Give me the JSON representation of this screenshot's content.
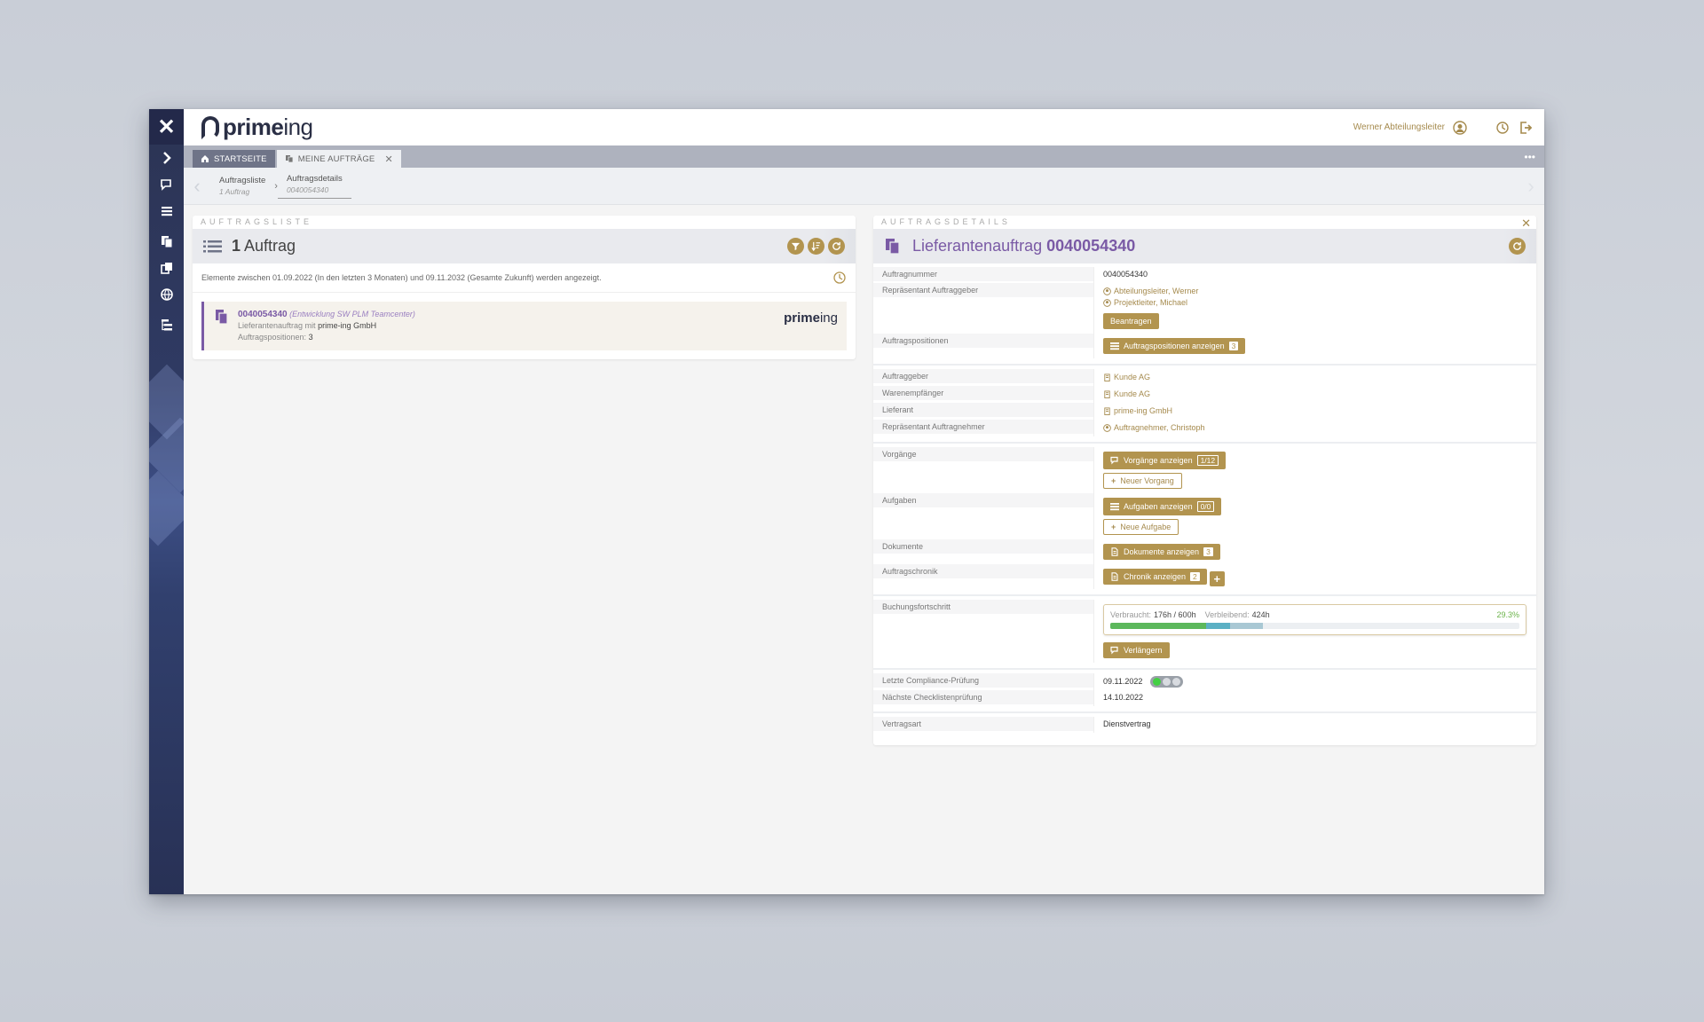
{
  "header": {
    "brand_prefix": "prime",
    "brand_suffix": "ing",
    "user_name": "Werner Abteilungsleiter"
  },
  "tabs": [
    {
      "label": "STARTSEITE"
    },
    {
      "label": "MEINE AUFTRÄGE"
    }
  ],
  "breadcrumb": [
    {
      "label": "Auftragsliste",
      "sub": "1 Auftrag"
    },
    {
      "label": "Auftragsdetails",
      "sub": "0040054340"
    }
  ],
  "left": {
    "section_title": "AUFTRAGSLISTE",
    "count": "1",
    "title_word": "Auftrag",
    "info": "Elemente zwischen 01.09.2022 (In den letzten 3 Monaten) und 09.11.2032 (Gesamte Zukunft) werden angezeigt.",
    "order": {
      "number": "0040054340",
      "subtitle": "(Entwicklung SW PLM Teamcenter)",
      "type_prefix": "Lieferantenauftrag mit",
      "supplier": "prime-ing GmbH",
      "positions_label": "Auftragspositionen:",
      "positions_value": "3",
      "logo_prefix": "prime",
      "logo_suffix": "ing"
    }
  },
  "right": {
    "section_title": "AUFTRAGSDETAILS",
    "title_prefix": "Lieferantenauftrag",
    "title_number": "0040054340",
    "fields": {
      "auftragsnummer_label": "Auftragnummer",
      "auftragsnummer": "0040054340",
      "repr_ag_label": "Repräsentant Auftraggeber",
      "repr_ag_1": "Abteilungsleiter, Werner",
      "repr_ag_2": "Projektleiter, Michael",
      "beantragen": "Beantragen",
      "positionen_label": "Auftragspositionen",
      "positionen_btn": "Auftragspositionen anzeigen",
      "positionen_count": "3",
      "auftraggeber_label": "Auftraggeber",
      "auftraggeber": "Kunde AG",
      "warenempfaenger_label": "Warenempfänger",
      "warenempfaenger": "Kunde AG",
      "lieferant_label": "Lieferant",
      "lieferant": "prime-ing GmbH",
      "repr_an_label": "Repräsentant Auftragnehmer",
      "repr_an": "Auftragnehmer, Christoph",
      "vorgaenge_label": "Vorgänge",
      "vorgaenge_btn": "Vorgänge anzeigen",
      "vorgaenge_count": "1/12",
      "neuer_vorgang": "Neuer Vorgang",
      "aufgaben_label": "Aufgaben",
      "aufgaben_btn": "Aufgaben anzeigen",
      "aufgaben_count": "0/0",
      "neue_aufgabe": "Neue Aufgabe",
      "dokumente_label": "Dokumente",
      "dokumente_btn": "Dokumente anzeigen",
      "dokumente_count": "3",
      "chronik_label": "Auftragschronik",
      "chronik_btn": "Chronik anzeigen",
      "chronik_count": "2",
      "buchung_label": "Buchungsfortschritt",
      "verbraucht_label": "Verbraucht:",
      "verbraucht": "176h / 600h",
      "verbleibend_label": "Verbleibend:",
      "verbleibend": "424h",
      "progress_pct": "29.3%",
      "verlaengern": "Verlängern",
      "compliance_label": "Letzte Compliance-Prüfung",
      "compliance_date": "09.11.2022",
      "checkliste_label": "Nächste Checklistenprüfung",
      "checkliste_date": "14.10.2022",
      "vertragsart_label": "Vertragsart",
      "vertragsart": "Dienstvertrag"
    }
  },
  "progress": {
    "consumed_fraction": 0.293
  },
  "colors": {
    "accent_gold": "#b2944f",
    "accent_purple": "#7a5aa5",
    "rail_dark": "#2c3454"
  }
}
